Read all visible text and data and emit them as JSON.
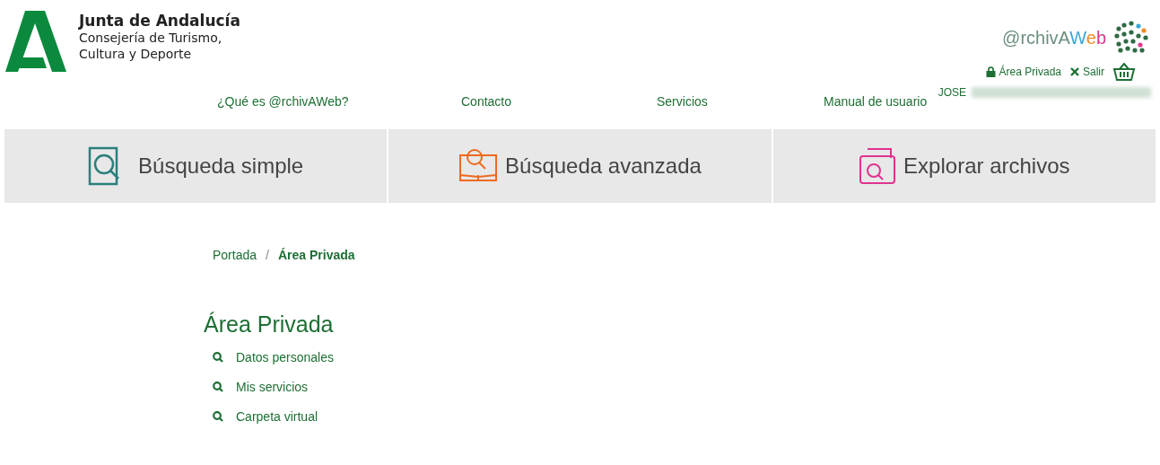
{
  "header": {
    "org_name": "Junta de Andalucía",
    "department_lines": [
      "Consejería de Turismo,",
      "Cultura y Deporte"
    ],
    "app_logo_parts": [
      {
        "text": "@rchivA",
        "color": "#6b8f7e"
      },
      {
        "text": "W",
        "color": "#3aa6d8"
      },
      {
        "text": "e",
        "color": "#f08a24"
      },
      {
        "text": "b",
        "color": "#e0378f"
      }
    ],
    "user_links": [
      {
        "kind": "lock",
        "label": "Área Privada"
      },
      {
        "kind": "close",
        "label": "Salir"
      }
    ],
    "user_name": "JOSE"
  },
  "nav": [
    "¿Qué es @rchivAWeb?",
    "Contacto",
    "Servicios",
    "Manual de usuario"
  ],
  "search_tabs": [
    {
      "kind": "simple",
      "label": "Búsqueda simple",
      "color": "#2b7f7c"
    },
    {
      "kind": "advanced",
      "label": "Búsqueda avanzada",
      "color": "#ee6a1f"
    },
    {
      "kind": "explore",
      "label": "Explorar archivos",
      "color": "#e0338f"
    }
  ],
  "breadcrumb_separator": "/",
  "breadcrumb": [
    {
      "label": "Portada",
      "current": false
    },
    {
      "label": "Área Privada",
      "current": true
    }
  ],
  "section": {
    "title": "Área Privada",
    "items": [
      "Datos personales",
      "Mis servicios",
      "Carpeta virtual"
    ]
  }
}
